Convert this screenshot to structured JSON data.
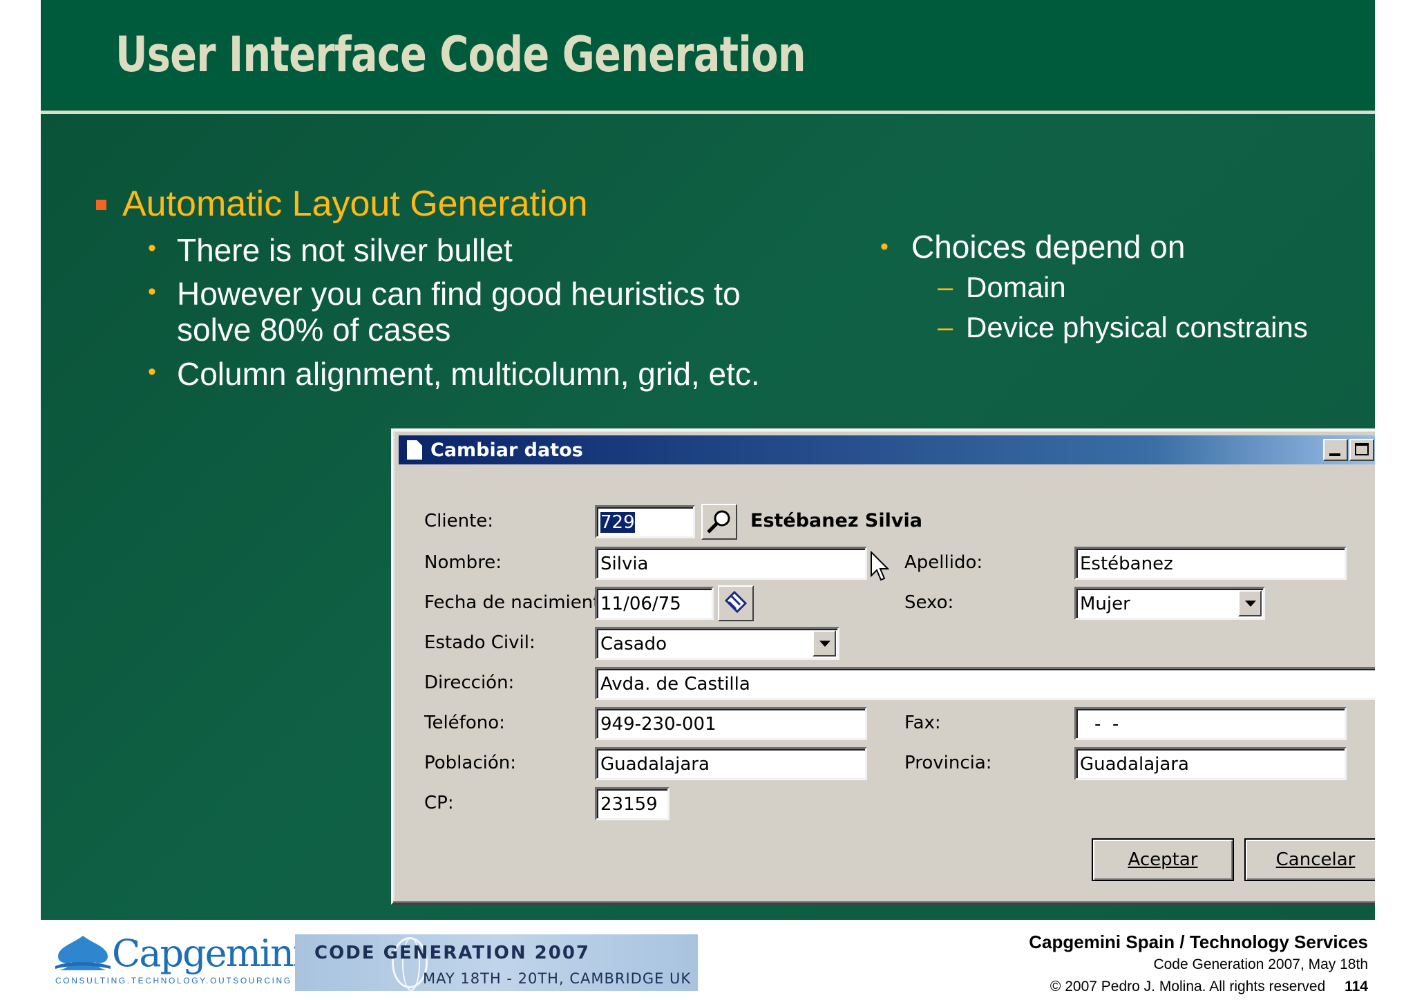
{
  "slide": {
    "title": "User Interface Code Generation",
    "main_bullet": "Automatic Layout Generation",
    "left_points": [
      "There is not silver bullet",
      "However you can find good heuristics to",
      "solve 80% of cases",
      "Column alignment, multicolumn, grid, etc."
    ],
    "right_heading": "Choices depend on",
    "right_items": [
      "Domain",
      "Device physical constrains"
    ]
  },
  "dialog": {
    "title": "Cambiar datos",
    "labels": {
      "cliente": "Cliente:",
      "nombre": "Nombre:",
      "apellido": "Apellido:",
      "fecha": "Fecha de nacimiento",
      "sexo": "Sexo:",
      "estado_civil": "Estado Civil:",
      "direccion": "Dirección:",
      "telefono": "Teléfono:",
      "fax": "Fax:",
      "poblacion": "Población:",
      "provincia": "Provincia:",
      "cp": "CP:"
    },
    "values": {
      "cliente": "729",
      "cliente_nombre": "Estébanez Silvia",
      "nombre": "Silvia",
      "apellido": "Estébanez",
      "fecha": "11/06/75",
      "sexo": "Mujer",
      "estado_civil": "Casado",
      "direccion": "Avda. de Castilla",
      "telefono": "949-230-001",
      "fax": "-  -",
      "poblacion": "Guadalajara",
      "provincia": "Guadalajara",
      "cp": "23159"
    },
    "buttons": {
      "aceptar": "Aceptar",
      "cancelar": "Cancelar"
    },
    "titlebar_gradient": [
      "#0a246a",
      "#a6caf0"
    ]
  },
  "footer": {
    "logo_text": "Capgemini",
    "logo_tagline": "CONSULTING.TECHNOLOGY.OUTSOURCING",
    "banner_title": "CODE GENERATION 2007",
    "banner_subtitle": "MAY 18TH - 20TH, CAMBRIDGE UK",
    "company": "Capgemini Spain / Technology Services",
    "event": "Code Generation 2007, May 18th",
    "copyright": "© 2007 Pedro J. Molina. All rights reserved",
    "page_number": "114"
  },
  "colors": {
    "slide_green": "#005a3c",
    "title_text": "#dcdcc0",
    "accent_yellow": "#ffb914",
    "bullet_orange": "#f26522",
    "dialog_gray": "#d4d0c8",
    "logo_blue": "#1f6eb5"
  }
}
